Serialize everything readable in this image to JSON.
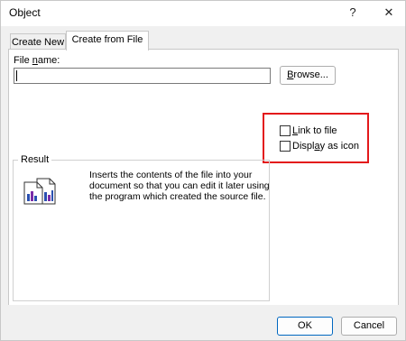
{
  "title": "Object",
  "titlebar": {
    "help": "?",
    "close": "✕"
  },
  "tabs": [
    {
      "label": "Create New",
      "active": false
    },
    {
      "label": "Create from File",
      "active": true
    }
  ],
  "file_name": {
    "label_prefix": "File ",
    "label_underlined": "n",
    "label_suffix": "ame:",
    "value": ""
  },
  "browse": {
    "label_underlined": "B",
    "label_rest": "rowse..."
  },
  "options": {
    "link": {
      "underlined": "L",
      "rest": "ink to file",
      "checked": false
    },
    "display": {
      "before": "Displ",
      "underlined": "a",
      "after": "y as icon",
      "checked": false
    }
  },
  "result": {
    "label": "Result",
    "text": "Inserts the contents of the file into your document so that you can edit it later using the program which created the source file."
  },
  "buttons": {
    "ok": "OK",
    "cancel": "Cancel"
  },
  "colors": {
    "highlight": "#e3191b",
    "accent": "#0067c0"
  }
}
